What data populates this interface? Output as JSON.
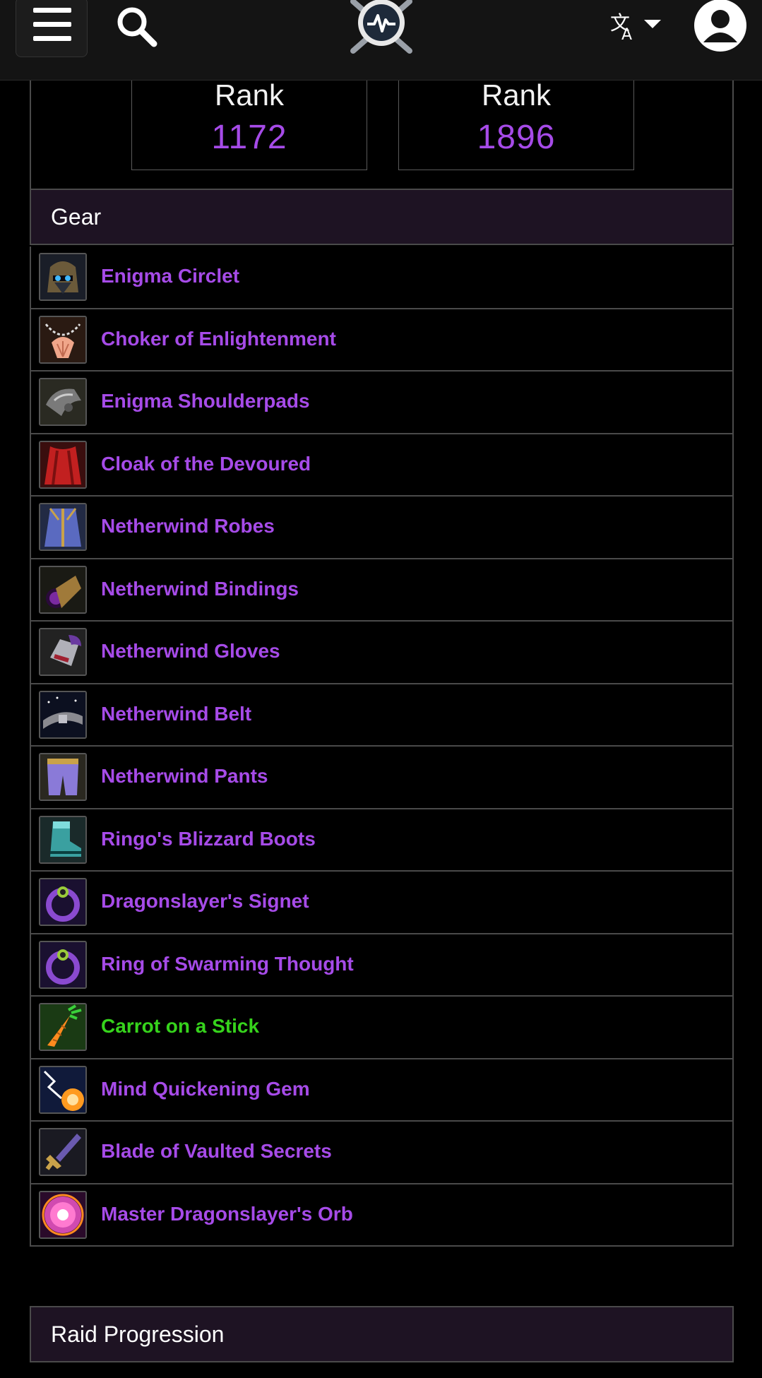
{
  "topbar": {
    "menu_icon": "hamburger-icon",
    "search_icon": "search-icon",
    "logo_icon": "site-logo",
    "language_icon": "translate-icon",
    "account_icon": "user-avatar-icon"
  },
  "ranks": [
    {
      "label": "Rank",
      "value": "1172"
    },
    {
      "label": "Rank",
      "value": "1896"
    }
  ],
  "gear": {
    "title": "Gear",
    "items": [
      {
        "name": "Enigma Circlet",
        "quality": "epic",
        "icon": "helmet-icon"
      },
      {
        "name": "Choker of Enlightenment",
        "quality": "epic",
        "icon": "necklace-icon"
      },
      {
        "name": "Enigma Shoulderpads",
        "quality": "epic",
        "icon": "shoulder-icon"
      },
      {
        "name": "Cloak of the Devoured",
        "quality": "epic",
        "icon": "cloak-icon"
      },
      {
        "name": "Netherwind Robes",
        "quality": "epic",
        "icon": "robe-icon"
      },
      {
        "name": "Netherwind Bindings",
        "quality": "epic",
        "icon": "bracer-icon"
      },
      {
        "name": "Netherwind Gloves",
        "quality": "epic",
        "icon": "gloves-icon"
      },
      {
        "name": "Netherwind Belt",
        "quality": "epic",
        "icon": "belt-icon"
      },
      {
        "name": "Netherwind Pants",
        "quality": "epic",
        "icon": "pants-icon"
      },
      {
        "name": "Ringo's Blizzard Boots",
        "quality": "epic",
        "icon": "boots-icon"
      },
      {
        "name": "Dragonslayer's Signet",
        "quality": "epic",
        "icon": "ring-icon"
      },
      {
        "name": "Ring of Swarming Thought",
        "quality": "epic",
        "icon": "ring-icon"
      },
      {
        "name": "Carrot on a Stick",
        "quality": "uncommon",
        "icon": "carrot-icon"
      },
      {
        "name": "Mind Quickening Gem",
        "quality": "epic",
        "icon": "gem-icon"
      },
      {
        "name": "Blade of Vaulted Secrets",
        "quality": "epic",
        "icon": "dagger-icon"
      },
      {
        "name": "Master Dragonslayer's Orb",
        "quality": "epic",
        "icon": "orb-icon"
      }
    ]
  },
  "raid_progression": {
    "title": "Raid Progression"
  },
  "colors": {
    "epic": "#a64be8",
    "uncommon": "#36d31c",
    "header_bg": "#1e1323",
    "border": "#4a4a4a"
  }
}
